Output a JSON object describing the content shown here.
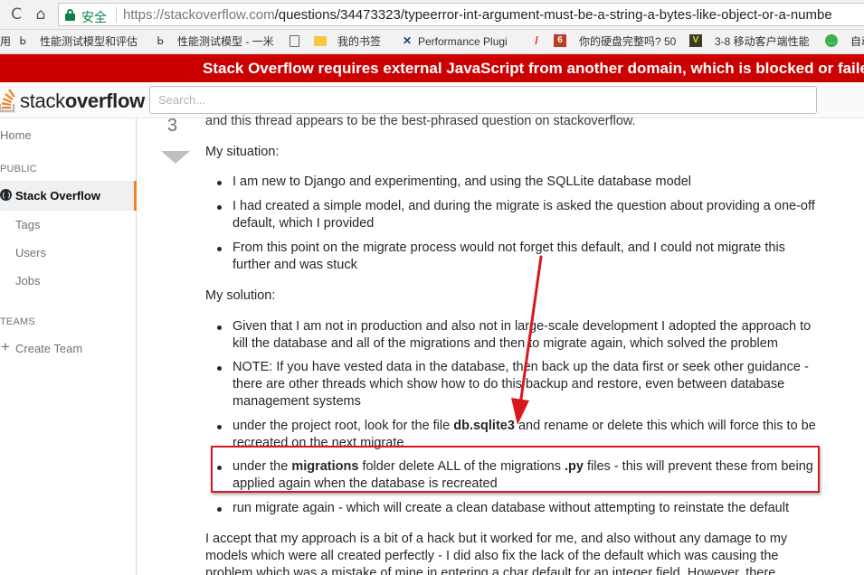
{
  "browser": {
    "back_glyph": "C",
    "home_glyph": "⌂",
    "secure_label": "安全",
    "url_host": "https://stackoverflow.com",
    "url_path": "/questions/34473323/typeerror-int-argument-must-be-a-string-a-bytes-like-object-or-a-numbe",
    "bookmarks": [
      {
        "label": "用",
        "icon": "none"
      },
      {
        "label": "性能测试模型和评估",
        "icon": "wrench-icon"
      },
      {
        "label": "性能测试模型 - 一米",
        "icon": "wrench-icon"
      },
      {
        "label": "我的书签",
        "icon": "folder-icon"
      },
      {
        "label": "Performance Plugi",
        "icon": "tools-icon"
      },
      {
        "label": "你的硬盘完整吗? 50",
        "icon": "app-icon"
      },
      {
        "label": "3-8 移动客户端性能",
        "icon": "app-icon"
      },
      {
        "label": "自动",
        "icon": "wechat-icon"
      }
    ]
  },
  "banner": {
    "text": "Stack Overflow requires external JavaScript from another domain, which is blocked or failed to load."
  },
  "header": {
    "logo_plain": "stack",
    "logo_bold": "overflow",
    "search_placeholder": "Search..."
  },
  "sidebar": {
    "home": "Home",
    "public_section": "PUBLIC",
    "stack_overflow": "Stack Overflow",
    "tags": "Tags",
    "users": "Users",
    "jobs": "Jobs",
    "teams_section": "TEAMS",
    "create_team": "Create Team",
    "accent_color": "#f48024"
  },
  "vote": {
    "count": "3"
  },
  "post": {
    "clipped_line": "and this thread appears to be the best-phrased question on stackoverflow.",
    "situation_heading": "My situation:",
    "situation_items": [
      "I am new to Django and experimenting, and using the SQLLite database model",
      "I had created a simple model, and during the migrate is asked the question about providing a one-off default, which I provided",
      "From this point on the migrate process would not forget this default, and I could not migrate this further and was stuck"
    ],
    "solution_heading": "My solution:",
    "solution_items": [
      "Given that I am not in production and also not in large-scale development I adopted the approach to kill the database and all of the migrations and then to migrate again, which solved the problem",
      "NOTE: If you have vested data in the database, then back up the data first or seek other guidance - there are other threads which show how to do this backup and restore, even between database management systems"
    ],
    "root_item": {
      "before": "under the project root, look for the file ",
      "bold": "db.sqlite3",
      "after": " and rename or delete this which will force this to be recreated on the next migrate"
    },
    "migrations_item": {
      "before": "under the ",
      "bold1": "migrations",
      "middle": " folder delete ALL of the migrations ",
      "bold2": ".py",
      "after": " files - this will prevent these from being applied again when the database is recreated"
    },
    "run_item": "run migrate again - which will create a clean database without attempting to reinstate the default",
    "closing": "I accept that my approach is a bit of a hack but it worked for me, and also without any damage to my models which were all created perfectly - I did also fix the lack of the default which was causing the problem which was a mistake of mine in entering a char default for an integer field. However, there"
  },
  "annotation": {
    "color": "#d9181e"
  }
}
